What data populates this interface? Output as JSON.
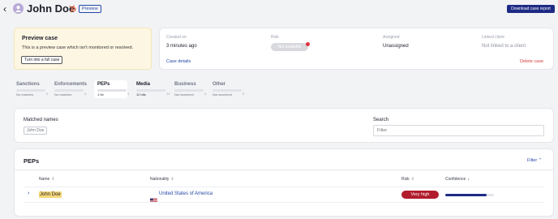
{
  "header": {
    "title": "John Doe",
    "preview_tag": "Preview",
    "download_label": "Download case report"
  },
  "preview_box": {
    "title": "Preview case",
    "description": "This is a preview case which isn't monitored or resolved.",
    "button_label": "Turn into a full case"
  },
  "case_info": {
    "created_label": "Created on",
    "created_value": "3 minutes ago",
    "risk_label": "Risk",
    "risk_value": "Not available",
    "assigned_label": "Assigned",
    "assigned_value": "Unassigned",
    "linked_label": "Linked client",
    "linked_value": "Not linked to a client",
    "details_link": "Case details",
    "delete_link": "Delete case"
  },
  "tabs": [
    {
      "label": "Sanctions",
      "sub": "No matches",
      "count": "0"
    },
    {
      "label": "Enforcements",
      "sub": "No matches",
      "count": "0"
    },
    {
      "label": "PEPs",
      "sub": "1 hit",
      "count": "1"
    },
    {
      "label": "Media",
      "sub": "12 hits",
      "count": "12"
    },
    {
      "label": "Business",
      "sub": "Not searched",
      "count": "0"
    },
    {
      "label": "Other",
      "sub": "Not searched",
      "count": "0"
    }
  ],
  "matched": {
    "label": "Matched names",
    "chip": "John Doe",
    "search_label": "Search",
    "search_placeholder": "Filter"
  },
  "table": {
    "title": "PEPs",
    "filter_label": "Filter",
    "columns": {
      "name": "Name",
      "nationality": "Nationality",
      "risk": "Risk",
      "confidence": "Confidence"
    },
    "rows": [
      {
        "name": "John Doe",
        "nationality": "United States of America",
        "risk": "Very high",
        "confidence": 0.85
      }
    ]
  },
  "colors": {
    "accent": "#1e2b84",
    "link": "#2448a8",
    "very_high": "#b11d2c",
    "preview_bg": "#fdf6e3"
  },
  "icons": {
    "back": "chevron-left-icon",
    "avatar": "user-icon",
    "hubspot": "hubspot-icon",
    "expand": "chevron-right-icon",
    "flag": "us-flag-icon"
  }
}
